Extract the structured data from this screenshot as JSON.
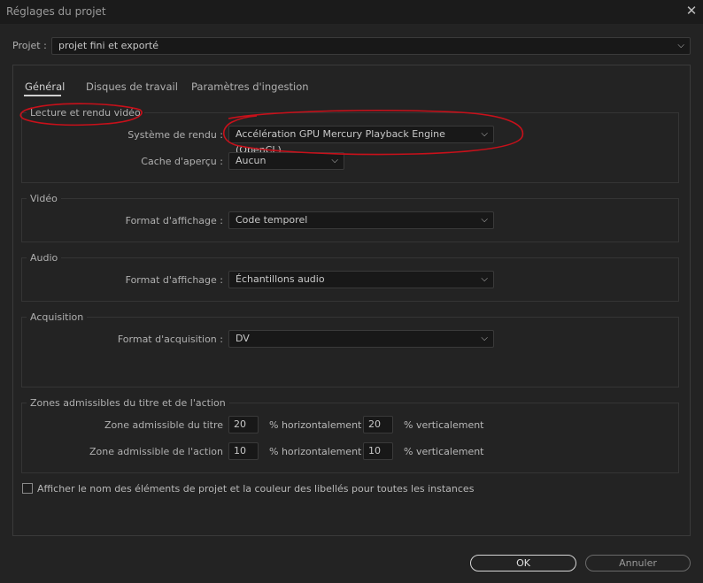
{
  "window": {
    "title": "Réglages du projet"
  },
  "project": {
    "label": "Projet :",
    "value": "projet fini et exporté"
  },
  "tabs": [
    {
      "label": "Général"
    },
    {
      "label": "Disques de travail"
    },
    {
      "label": "Paramètres d'ingestion"
    }
  ],
  "playback": {
    "title": "Lecture et rendu vidéo",
    "renderer_label": "Système de rendu :",
    "renderer_value": "Accélération GPU Mercury Playback Engine (OpenCL)",
    "preview_cache_label": "Cache d'aperçu :",
    "preview_cache_value": "Aucun"
  },
  "video": {
    "title": "Vidéo",
    "display_label": "Format d'affichage :",
    "display_value": "Code temporel"
  },
  "audio": {
    "title": "Audio",
    "display_label": "Format d'affichage :",
    "display_value": "Échantillons audio"
  },
  "capture": {
    "title": "Acquisition",
    "format_label": "Format d'acquisition :",
    "format_value": "DV"
  },
  "safe": {
    "title": "Zones admissibles du titre et de l'action",
    "title_label": "Zone admissible du titre",
    "title_h": "20",
    "title_v": "20",
    "action_label": "Zone admissible de l'action",
    "action_h": "10",
    "action_v": "10",
    "horiz_label": "% horizontalement",
    "vert_label": "% verticalement"
  },
  "options": {
    "show_names_label": "Afficher le nom des éléments de projet et la couleur des libellés pour toutes les instances"
  },
  "buttons": {
    "ok": "OK",
    "cancel": "Annuler"
  },
  "colors": {
    "annotation": "#c8101a",
    "ok_border": "#d6d6d6"
  },
  "icons": {
    "close": "close-icon",
    "dropdown": "chevron-down-icon"
  }
}
